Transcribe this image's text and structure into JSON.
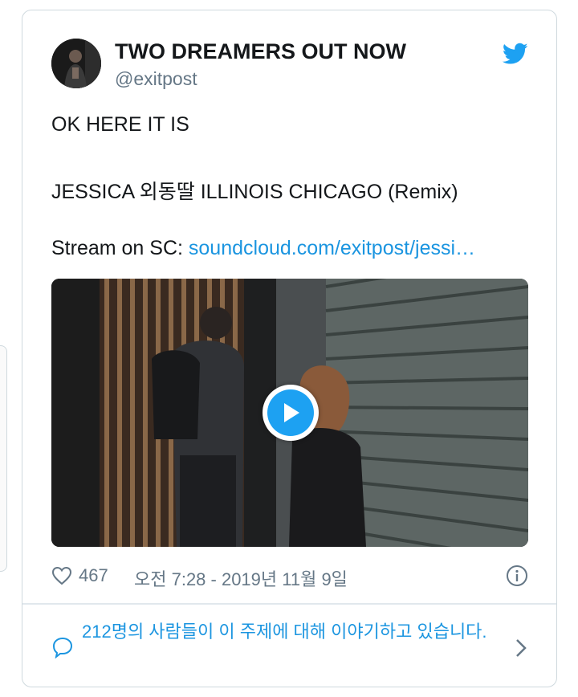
{
  "tweet": {
    "display_name": "TWO DREAMERS OUT NOW",
    "handle": "@exitpost",
    "line1": "OK HERE IT IS",
    "line2": "JESSICA 외동딸 ILLINOIS CHICAGO (Remix)",
    "line3_prefix": "Stream on SC: ",
    "link_text": "soundcloud.com/exitpost/jessi…",
    "likes": "467",
    "timestamp": "오전 7:28 - 2019년 11월 9일",
    "conversation": "212명의 사람들이 이 주제에 대해 이야기하고 있습니다."
  },
  "icons": {
    "brand": "twitter-bird-icon",
    "play": "play-icon",
    "like": "heart-icon",
    "info": "info-icon",
    "conversation": "speech-bubble-icon",
    "chevron": "chevron-right-icon"
  },
  "colors": {
    "link": "#1b95e0",
    "brand": "#1da1f2",
    "muted": "#657786",
    "border": "#cfd9de"
  }
}
